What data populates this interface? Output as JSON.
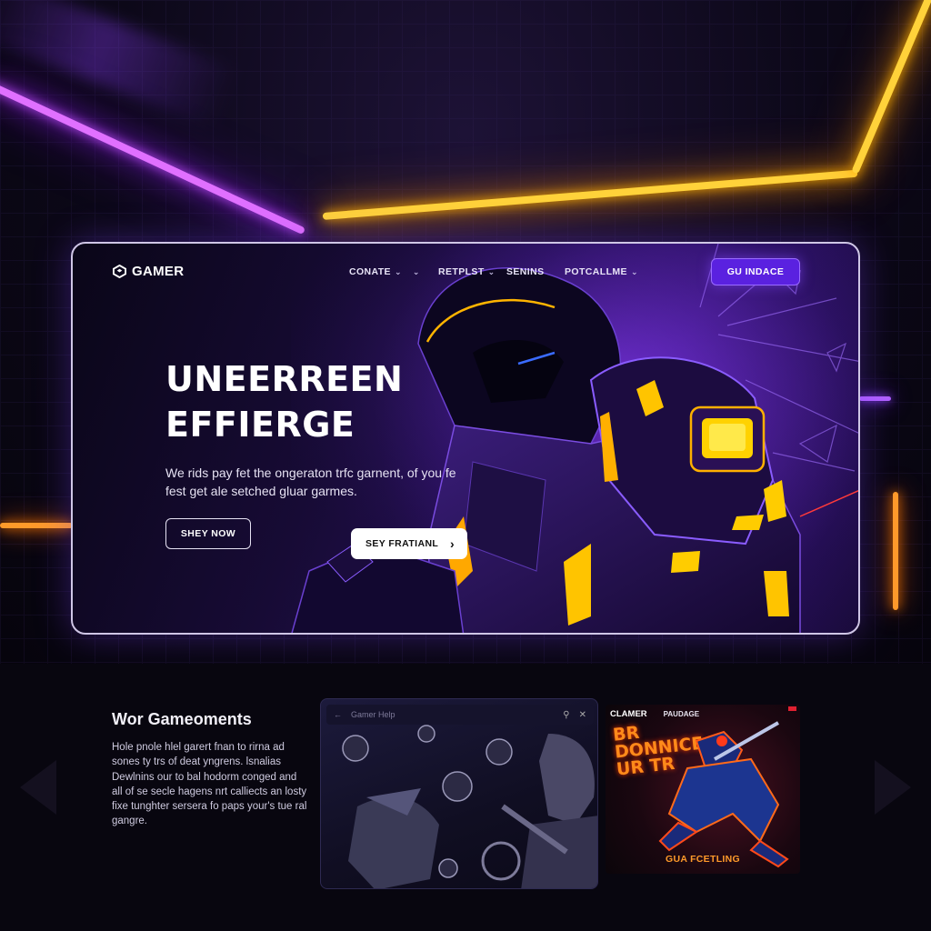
{
  "brand": {
    "name": "GAMER",
    "accent": "#5a21e0",
    "neon_purple": "#e070ff",
    "neon_gold": "#ffd23a"
  },
  "nav": {
    "items": [
      {
        "label": "CONATE",
        "dropdown": true
      },
      {
        "label": "RETPLST",
        "dropdown": true
      },
      {
        "label": "SENINS",
        "dropdown": false
      },
      {
        "label": "POTCALLME",
        "dropdown": true
      }
    ],
    "cta": "GU INDACE"
  },
  "hero": {
    "headline_line1": "UNEERREEN",
    "headline_line2": "EFFIERGE",
    "subtext": "We rids pay fet the ongeraton trfc garnent, of you fe fest get ale setched gluar garmes.",
    "primary_button": "SHEY NOW",
    "secondary_button": "SEY FRATIANL"
  },
  "lower": {
    "title": "Wor Gameoments",
    "body": "Hole pnole hlel garert fnan to rirna ad sones ty trs of deat yngrens. lsnalias Dewlnins our to bal hodorm conged and all of se secle hagens nrt calliects an losty fixe tunghter sersera fo paps your's tue ral gangre.",
    "card_a": {
      "search_placeholder": "Gamer Help"
    },
    "card_b": {
      "brand": "CLAMER",
      "tag": "PAUDAGE",
      "title": "BR DONNICE UR TR",
      "footer": "GUA FCETLING"
    }
  }
}
